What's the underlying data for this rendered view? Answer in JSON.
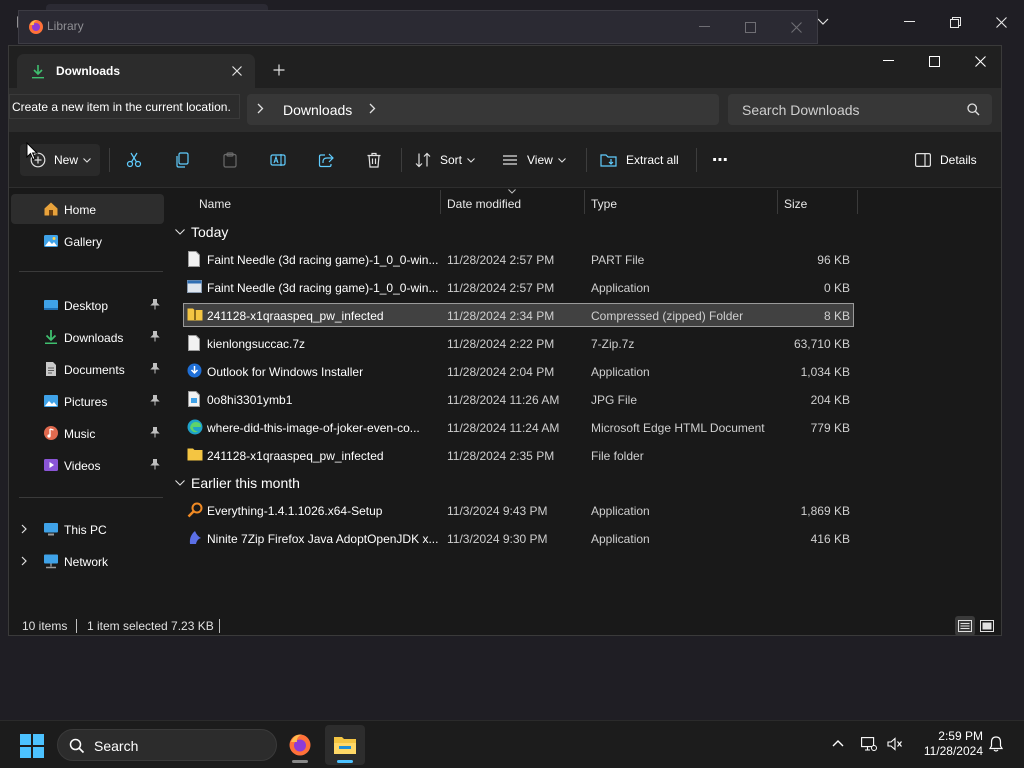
{
  "library": {
    "title": "Library"
  },
  "explorer": {
    "tab": {
      "label": "Downloads"
    },
    "tooltip": "Create a new item in the current location.",
    "breadcrumb": [
      "Downloads"
    ],
    "search": {
      "placeholder": "Search Downloads"
    },
    "toolbar": {
      "new_label": "New",
      "sort_label": "Sort",
      "view_label": "View",
      "extract_label": "Extract all",
      "more_label": "⋯",
      "details_label": "Details"
    },
    "nav": {
      "home": "Home",
      "gallery": "Gallery",
      "desktop": "Desktop",
      "downloads": "Downloads",
      "documents": "Documents",
      "pictures": "Pictures",
      "music": "Music",
      "videos": "Videos",
      "this_pc": "This PC",
      "network": "Network"
    },
    "columns": {
      "name": "Name",
      "date": "Date modified",
      "type": "Type",
      "size": "Size"
    },
    "groups": [
      {
        "label": "Today",
        "files": [
          {
            "icon": "document-icon",
            "name": "Faint Needle (3d racing game)-1_0_0-win...",
            "date": "11/28/2024 2:57 PM",
            "type": "PART File",
            "size": "96 KB"
          },
          {
            "icon": "application-icon",
            "name": "Faint Needle (3d racing game)-1_0_0-win...",
            "date": "11/28/2024 2:57 PM",
            "type": "Application",
            "size": "0 KB"
          },
          {
            "icon": "zip-folder-icon",
            "name": "241128-x1qraaspeq_pw_infected",
            "date": "11/28/2024 2:34 PM",
            "type": "Compressed (zipped) Folder",
            "size": "8 KB"
          },
          {
            "icon": "document-icon",
            "name": "kienlongsuccac.7z",
            "date": "11/28/2024 2:22 PM",
            "type": "7-Zip.7z",
            "size": "63,710 KB"
          },
          {
            "icon": "installer-icon",
            "name": "Outlook for Windows Installer",
            "date": "11/28/2024 2:04 PM",
            "type": "Application",
            "size": "1,034 KB"
          },
          {
            "icon": "image-file-icon",
            "name": "0o8hi3301ymb1",
            "date": "11/28/2024 11:26 AM",
            "type": "JPG File",
            "size": "204 KB"
          },
          {
            "icon": "edge-icon",
            "name": "where-did-this-image-of-joker-even-co...",
            "date": "11/28/2024 11:24 AM",
            "type": "Microsoft Edge HTML Document",
            "size": "779 KB"
          },
          {
            "icon": "folder-icon",
            "name": "241128-x1qraaspeq_pw_infected",
            "date": "11/28/2024 2:35 PM",
            "type": "File folder",
            "size": ""
          }
        ]
      },
      {
        "label": "Earlier this month",
        "files": [
          {
            "icon": "search-app-icon",
            "name": "Everything-1.4.1.1026.x64-Setup",
            "date": "11/3/2024 9:43 PM",
            "type": "Application",
            "size": "1,869 KB"
          },
          {
            "icon": "ninite-icon",
            "name": "Ninite 7Zip Firefox Java AdoptOpenJDK x...",
            "date": "11/3/2024 9:30 PM",
            "type": "Application",
            "size": "416 KB"
          }
        ]
      }
    ],
    "status": {
      "count": "10 items",
      "selected": "1 item selected  7.23 KB"
    }
  },
  "taskbar": {
    "search_label": "Search",
    "time": "2:59 PM",
    "date": "11/28/2024"
  },
  "colors": {
    "accent": "#4cc2ff",
    "folder": "#f4c542",
    "selected_row": "#414141",
    "background": "#191919"
  }
}
